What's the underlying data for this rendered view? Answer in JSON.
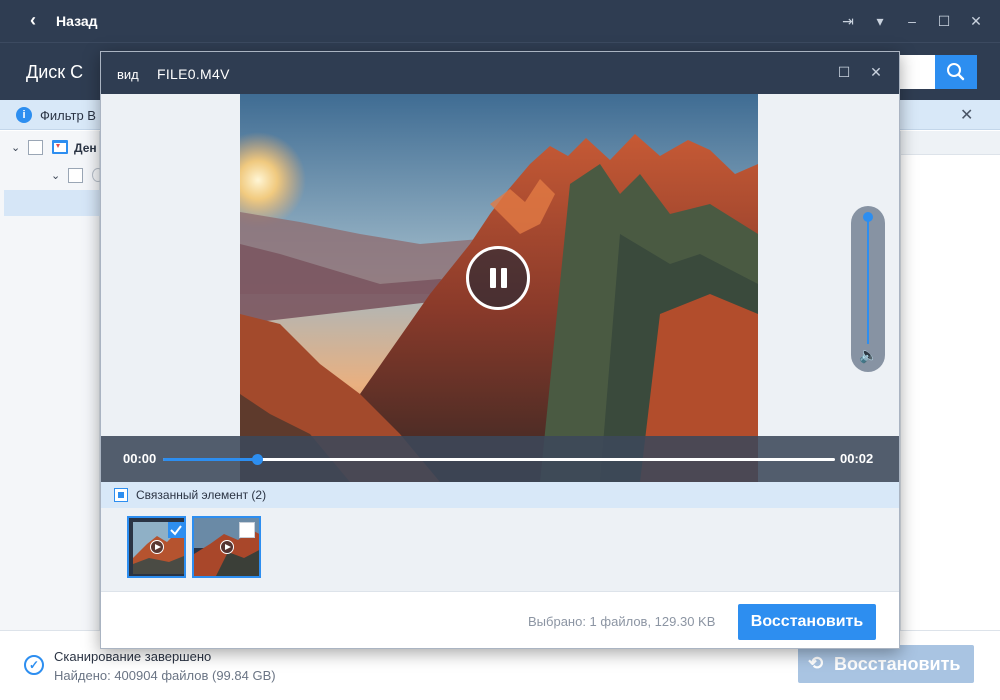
{
  "app": {
    "back_label": "Назад",
    "window_controls": [
      "export-icon",
      "dropdown-icon",
      "minimize-icon",
      "maximize-icon",
      "close-icon"
    ]
  },
  "header": {
    "title": "Диск C"
  },
  "filter_bar": {
    "text": "Фильтр В"
  },
  "tree": {
    "items": [
      {
        "label": "Ден"
      }
    ]
  },
  "footer": {
    "status": "Сканирование завершено",
    "found": "Найдено: 400904 файлов (99.84 GB)",
    "restore_label": "Восстановить"
  },
  "dialog": {
    "view_label": "вид",
    "file_name": "FILE0.M4V",
    "player": {
      "time_current": "00:00",
      "time_total": "00:02",
      "progress_fraction": 0.14,
      "volume_fraction": 1.0,
      "state": "playing"
    },
    "related": {
      "label": "Связанный элемент (2)",
      "thumbnails": [
        {
          "checked": true
        },
        {
          "checked": false
        }
      ]
    },
    "selected_info": "Выбрано: 1 файлов, 129.30 KB",
    "restore_label": "Восстановить"
  },
  "colors": {
    "titlebar": "#2f3d52",
    "accent": "#2d8ef0",
    "filter_bar": "#d8e8f8",
    "disabled_button": "#a9c4e2"
  }
}
